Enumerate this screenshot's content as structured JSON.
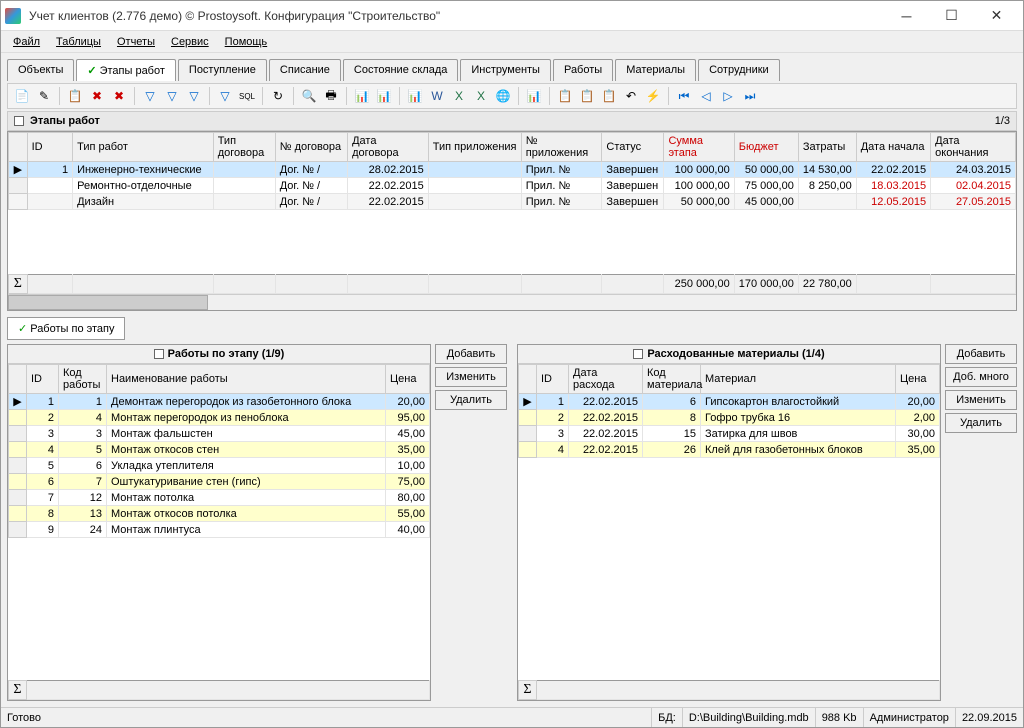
{
  "window": {
    "title": "Учет клиентов (2.776 демо) © Prostoysoft. Конфигурация \"Строительство\""
  },
  "menu": [
    "Файл",
    "Таблицы",
    "Отчеты",
    "Сервис",
    "Помощь"
  ],
  "main_tabs": [
    "Объекты",
    "Этапы работ",
    "Поступление",
    "Списание",
    "Состояние склада",
    "Инструменты",
    "Работы",
    "Материалы",
    "Сотрудники"
  ],
  "main_tabs_active": 1,
  "panel": {
    "title": "Этапы работ",
    "pager": "1/3"
  },
  "columns": [
    "ID",
    "Тип работ",
    "Тип договора",
    "№ договора",
    "Дата договора",
    "Тип приложения",
    "№ приложения",
    "Статус",
    "Сумма этапа",
    "Бюджет",
    "Затраты",
    "Дата начала",
    "Дата окончания"
  ],
  "rows": [
    {
      "id": "1",
      "type": "Инженерно-технические",
      "contract": "Дог. № /",
      "cdate": "28.02.2015",
      "app": "Прил. №",
      "status": "Завершен",
      "sum": "100 000,00",
      "budget": "50 000,00",
      "cost": "14 530,00",
      "start": "22.02.2015",
      "end": "24.03.2015",
      "red": false
    },
    {
      "id": "",
      "type": "Ремонтно-отделочные",
      "contract": "Дог. № /",
      "cdate": "22.02.2015",
      "app": "Прил. №",
      "status": "Завершен",
      "sum": "100 000,00",
      "budget": "75 000,00",
      "cost": "8 250,00",
      "start": "18.03.2015",
      "end": "02.04.2015",
      "red": true
    },
    {
      "id": "",
      "type": "Дизайн",
      "contract": "Дог. № /",
      "cdate": "22.02.2015",
      "app": "Прил. №",
      "status": "Завершен",
      "sum": "50 000,00",
      "budget": "45 000,00",
      "cost": "",
      "start": "12.05.2015",
      "end": "27.05.2015",
      "red": true
    }
  ],
  "totals": {
    "sum": "250 000,00",
    "budget": "170 000,00",
    "cost": "22 780,00"
  },
  "sub_tab": "Работы по этапу",
  "works": {
    "title": "Работы по этапу (1/9)",
    "cols": [
      "ID",
      "Код работы",
      "Наименование работы",
      "Цена"
    ],
    "rows": [
      {
        "n": "1",
        "id": "1",
        "code": "1",
        "name": "Демонтаж перегородок из газобетонного блока",
        "price": "20,00",
        "sel": true
      },
      {
        "n": "2",
        "id": "2",
        "code": "4",
        "name": "Монтаж перегородок из пеноблока",
        "price": "95,00",
        "yel": true
      },
      {
        "n": "3",
        "id": "3",
        "code": "3",
        "name": "Монтаж фальшстен",
        "price": "45,00"
      },
      {
        "n": "4",
        "id": "4",
        "code": "5",
        "name": "Монтаж откосов стен",
        "price": "35,00",
        "yel": true
      },
      {
        "n": "5",
        "id": "5",
        "code": "6",
        "name": "Укладка утеплителя",
        "price": "10,00"
      },
      {
        "n": "6",
        "id": "6",
        "code": "7",
        "name": "Оштукатуривание стен (гипс)",
        "price": "75,00",
        "yel": true
      },
      {
        "n": "7",
        "id": "7",
        "code": "12",
        "name": "Монтаж потолка",
        "price": "80,00"
      },
      {
        "n": "8",
        "id": "8",
        "code": "13",
        "name": "Монтаж откосов потолка",
        "price": "55,00",
        "yel": true
      },
      {
        "n": "9",
        "id": "9",
        "code": "24",
        "name": "Монтаж плинтуса",
        "price": "40,00"
      }
    ]
  },
  "materials": {
    "title": "Расходованные материалы (1/4)",
    "cols": [
      "ID",
      "Дата расхода",
      "Код материала",
      "Материал",
      "Цена"
    ],
    "rows": [
      {
        "n": "1",
        "id": "1",
        "date": "22.02.2015",
        "code": "6",
        "name": "Гипсокартон влагостойкий",
        "price": "20,00",
        "sel": true
      },
      {
        "n": "2",
        "id": "2",
        "date": "22.02.2015",
        "code": "8",
        "name": "Гофро трубка 16",
        "price": "2,00",
        "yel": true
      },
      {
        "n": "3",
        "id": "3",
        "date": "22.02.2015",
        "code": "15",
        "name": "Затирка для швов",
        "price": "30,00"
      },
      {
        "n": "4",
        "id": "4",
        "date": "22.02.2015",
        "code": "26",
        "name": "Клей для газобетонных блоков",
        "price": "35,00",
        "yel": true
      }
    ]
  },
  "buttons": {
    "add": "Добавить",
    "add_many": "Доб. много",
    "edit": "Изменить",
    "del": "Удалить"
  },
  "status": {
    "ready": "Готово",
    "db_lbl": "БД:",
    "db": "D:\\Building\\Building.mdb",
    "size": "988 Kb",
    "user": "Администратор",
    "date": "22.09.2015"
  }
}
